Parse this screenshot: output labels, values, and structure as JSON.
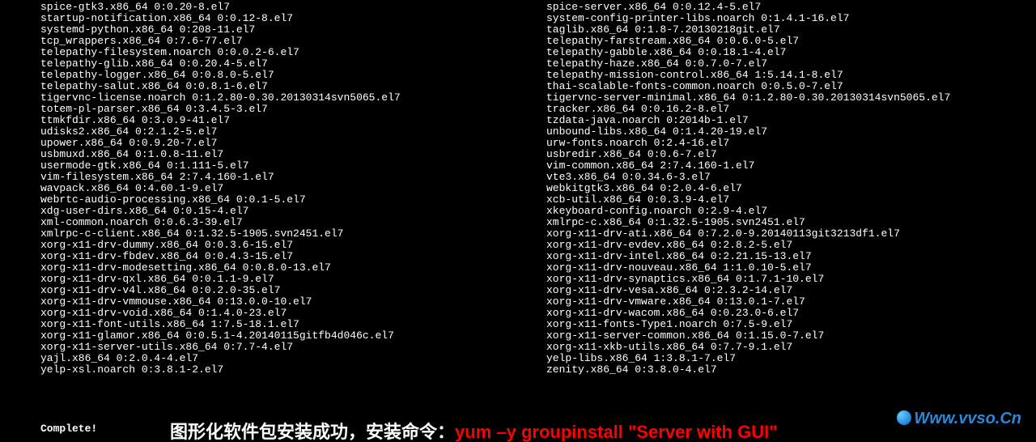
{
  "packages": {
    "left": [
      "spice-gtk3.x86_64 0:0.20-8.el7",
      "startup-notification.x86_64 0:0.12-8.el7",
      "systemd-python.x86_64 0:208-11.el7",
      "tcp_wrappers.x86_64 0:7.6-77.el7",
      "telepathy-filesystem.noarch 0:0.0.2-6.el7",
      "telepathy-glib.x86_64 0:0.20.4-5.el7",
      "telepathy-logger.x86_64 0:0.8.0-5.el7",
      "telepathy-salut.x86_64 0:0.8.1-6.el7",
      "tigervnc-license.noarch 0:1.2.80-0.30.20130314svn5065.el7",
      "totem-pl-parser.x86_64 0:3.4.5-3.el7",
      "ttmkfdir.x86_64 0:3.0.9-41.el7",
      "udisks2.x86_64 0:2.1.2-5.el7",
      "upower.x86_64 0:0.9.20-7.el7",
      "usbmuxd.x86_64 0:1.0.8-11.el7",
      "usermode-gtk.x86_64 0:1.111-5.el7",
      "vim-filesystem.x86_64 2:7.4.160-1.el7",
      "wavpack.x86_64 0:4.60.1-9.el7",
      "webrtc-audio-processing.x86_64 0:0.1-5.el7",
      "xdg-user-dirs.x86_64 0:0.15-4.el7",
      "xml-common.noarch 0:0.6.3-39.el7",
      "xmlrpc-c-client.x86_64 0:1.32.5-1905.svn2451.el7",
      "xorg-x11-drv-dummy.x86_64 0:0.3.6-15.el7",
      "xorg-x11-drv-fbdev.x86_64 0:0.4.3-15.el7",
      "xorg-x11-drv-modesetting.x86_64 0:0.8.0-13.el7",
      "xorg-x11-drv-qxl.x86_64 0:0.1.1-9.el7",
      "xorg-x11-drv-v4l.x86_64 0:0.2.0-35.el7",
      "xorg-x11-drv-vmmouse.x86_64 0:13.0.0-10.el7",
      "xorg-x11-drv-void.x86_64 0:1.4.0-23.el7",
      "xorg-x11-font-utils.x86_64 1:7.5-18.1.el7",
      "xorg-x11-glamor.x86_64 0:0.5.1-4.20140115gitfb4d046c.el7",
      "xorg-x11-server-utils.x86_64 0:7.7-4.el7",
      "yajl.x86_64 0:2.0.4-4.el7",
      "yelp-xsl.noarch 0:3.8.1-2.el7"
    ],
    "right": [
      "spice-server.x86_64 0:0.12.4-5.el7",
      "system-config-printer-libs.noarch 0:1.4.1-16.el7",
      "taglib.x86_64 0:1.8-7.20130218git.el7",
      "telepathy-farstream.x86_64 0:0.6.0-5.el7",
      "telepathy-gabble.x86_64 0:0.18.1-4.el7",
      "telepathy-haze.x86_64 0:0.7.0-7.el7",
      "telepathy-mission-control.x86_64 1:5.14.1-8.el7",
      "thai-scalable-fonts-common.noarch 0:0.5.0-7.el7",
      "tigervnc-server-minimal.x86_64 0:1.2.80-0.30.20130314svn5065.el7",
      "tracker.x86_64 0:0.16.2-8.el7",
      "tzdata-java.noarch 0:2014b-1.el7",
      "unbound-libs.x86_64 0:1.4.20-19.el7",
      "urw-fonts.noarch 0:2.4-16.el7",
      "usbredir.x86_64 0:0.6-7.el7",
      "vim-common.x86_64 2:7.4.160-1.el7",
      "vte3.x86_64 0:0.34.6-3.el7",
      "webkitgtk3.x86_64 0:2.0.4-6.el7",
      "xcb-util.x86_64 0:0.3.9-4.el7",
      "xkeyboard-config.noarch 0:2.9-4.el7",
      "xmlrpc-c.x86_64 0:1.32.5-1905.svn2451.el7",
      "xorg-x11-drv-ati.x86_64 0:7.2.0-9.20140113git3213df1.el7",
      "xorg-x11-drv-evdev.x86_64 0:2.8.2-5.el7",
      "xorg-x11-drv-intel.x86_64 0:2.21.15-13.el7",
      "xorg-x11-drv-nouveau.x86_64 1:1.0.10-5.el7",
      "xorg-x11-drv-synaptics.x86_64 0:1.7.1-10.el7",
      "xorg-x11-drv-vesa.x86_64 0:2.3.2-14.el7",
      "xorg-x11-drv-vmware.x86_64 0:13.0.1-7.el7",
      "xorg-x11-drv-wacom.x86_64 0:0.23.0-6.el7",
      "xorg-x11-fonts-Type1.noarch 0:7.5-9.el7",
      "xorg-x11-server-common.x86_64 0:1.15.0-7.el7",
      "xorg-x11-xkb-utils.x86_64 0:7.7-9.1.el7",
      "yelp-libs.x86_64 1:3.8.1-7.el7",
      "zenity.x86_64 0:3.8.0-4.el7"
    ]
  },
  "complete_text": "Complete!",
  "caption": {
    "prefix": "图形化软件包安装成功，安装命令：",
    "command": "yum –y groupinstall \"Server with GUI\""
  },
  "watermark": "Www.vvso.Cn"
}
